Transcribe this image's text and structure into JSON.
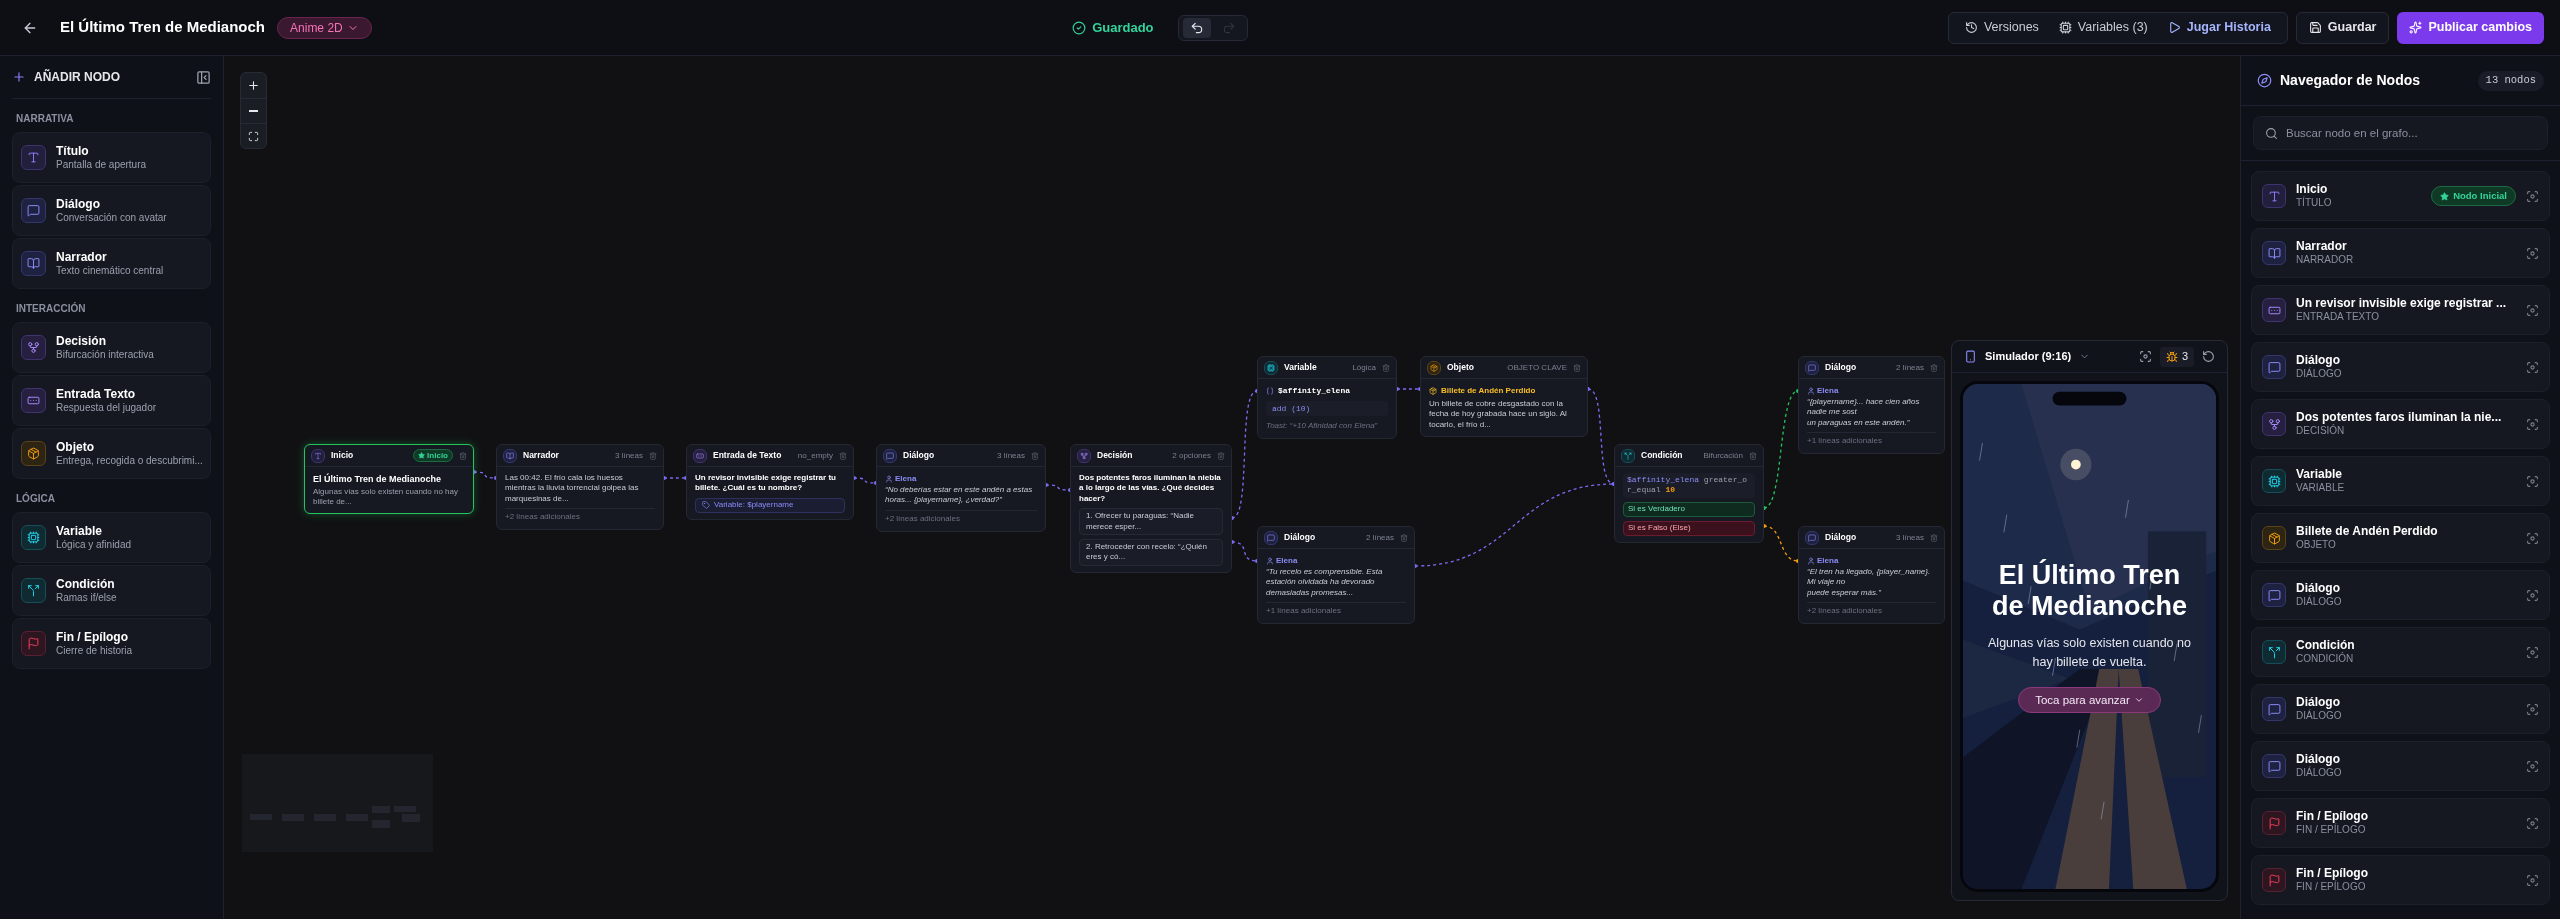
{
  "header": {
    "title": "El Último Tren de Medianoch",
    "tag": "Anime 2D",
    "status": "Guardado",
    "history": [
      {
        "kind": "undo",
        "disabled": false
      },
      {
        "kind": "redo",
        "disabled": true
      }
    ],
    "tools": [
      {
        "kind": "versions",
        "label": "Versiones"
      },
      {
        "kind": "variables",
        "label": "Variables (3)"
      },
      {
        "kind": "play",
        "label": "Jugar Historia"
      }
    ],
    "save": "Guardar",
    "publish": "Publicar cambios"
  },
  "sidebar": {
    "heading": "AÑADIR NODO",
    "sections": [
      {
        "title": "NARRATIVA",
        "items": [
          {
            "kind": "title",
            "title": "Título",
            "subtitle": "Pantalla de apertura"
          },
          {
            "kind": "dialog",
            "title": "Diálogo",
            "subtitle": "Conversación con avatar"
          },
          {
            "kind": "narrator",
            "title": "Narrador",
            "subtitle": "Texto cinemático central"
          }
        ]
      },
      {
        "title": "INTERACCIÓN",
        "items": [
          {
            "kind": "decision",
            "title": "Decisión",
            "subtitle": "Bifurcación interactiva"
          },
          {
            "kind": "input",
            "title": "Entrada Texto",
            "subtitle": "Respuesta del jugador"
          },
          {
            "kind": "object",
            "title": "Objeto",
            "subtitle": "Entrega, recogida o descubrimi..."
          }
        ]
      },
      {
        "title": "LÓGICA",
        "items": [
          {
            "kind": "variable",
            "title": "Variable",
            "subtitle": "Lógica y afinidad"
          },
          {
            "kind": "condition",
            "title": "Condición",
            "subtitle": "Ramas if/else"
          },
          {
            "kind": "end",
            "title": "Fin / Epílogo",
            "subtitle": "Cierre de historia"
          }
        ]
      }
    ]
  },
  "canvas": {
    "nodes": [
      {
        "kind": "title",
        "title": "Inicio",
        "selected": true,
        "badge": "Inicio",
        "heading": "El Último Tren de Medianoche",
        "text": "Algunas vías solo existen cuando no hay billete de..."
      },
      {
        "kind": "narrator",
        "title": "Narrador",
        "selected": false,
        "meta": "3 líneas",
        "text": "Las 00:42. El frío cala los huesos mientras la lluvia torrencial golpea las marquesinas de...",
        "footer": "+2 líneas adicionales"
      },
      {
        "kind": "input",
        "title": "Entrada de Texto",
        "selected": false,
        "meta": "no_empty",
        "heading": "Un revisor invisible exige registrar tu billete. ¿Cuál es tu nombre?",
        "field": "Variable: $playername"
      },
      {
        "kind": "dialog",
        "title": "Diálogo",
        "selected": false,
        "meta": "3 líneas",
        "speaker": "Elena",
        "lines": [
          "“No deberías estar en este andén a estas horas... {playername}, ¿verdad?”"
        ],
        "footer": "+2 líneas adicionales"
      },
      {
        "kind": "decision",
        "title": "Decisión",
        "selected": false,
        "meta": "2 opciones",
        "heading": "Dos potentes faros iluminan la niebla a lo largo de las vías. ¿Qué decides hacer?",
        "options": [
          "1. Ofrecer tu paraguas: “Nadie merece esper...",
          "2. Retroceder con recelo: “¿Quién eres y có..."
        ]
      },
      {
        "kind": "variable",
        "title": "Variable",
        "selected": false,
        "meta": "Lógica",
        "variable": "$affinity_elena",
        "operation": "add (10)",
        "toast": "Toast: “+10 Afinidad con Elena”"
      },
      {
        "kind": "object",
        "title": "Objeto",
        "selected": false,
        "meta": "OBJETO CLAVE",
        "name": "Billete de Andén Perdido",
        "text": "Un billete de cobre desgastado con la fecha de hoy grabada hace un siglo. Al tocarlo, el frío d..."
      },
      {
        "kind": "dialog",
        "title": "Diálogo",
        "selected": false,
        "meta": "2 líneas",
        "speaker": "Elena",
        "lines": [
          "“Tu recelo es comprensible. Esta estación olvidada ha devorado demasiadas promesas..."
        ],
        "footer": "+1 líneas adicionales"
      },
      {
        "kind": "condition",
        "title": "Condición",
        "selected": false,
        "meta": "Bifurcación",
        "expression": {
          "variable": "$affinity_elena",
          "operator": "greater_or_equal",
          "value": "10"
        },
        "branches": [
          {
            "kind": "true",
            "label": "Si es Verdadero"
          },
          {
            "kind": "false",
            "label": "Si es Falso (Else)"
          }
        ]
      },
      {
        "kind": "dialog",
        "title": "Diálogo",
        "selected": false,
        "meta": "2 líneas",
        "speaker": "Elena",
        "lines": [
          "“{playername}... hace cien años nadie me sost",
          "un paraguas en este andén.”"
        ],
        "footer": "+1 líneas adicionales"
      },
      {
        "kind": "dialog",
        "title": "Diálogo",
        "selected": false,
        "meta": "3 líneas",
        "speaker": "Elena",
        "lines": [
          "“El tren ha llegado, {player_name}. Mi viaje no",
          "puede esperar más.”"
        ],
        "footer": "+2 líneas adicionales"
      }
    ]
  },
  "simulator": {
    "title": "Simulador (9:16)",
    "bugs": "3",
    "heading": "El Último Tren de Medianoche",
    "subtitle": "Algunas vías solo existen cuando no hay billete de vuelta.",
    "button": "Toca para avanzar"
  },
  "navigator": {
    "title": "Navegador de Nodos",
    "count": "13 nodos",
    "search": {
      "placeholder": "Buscar nodo en el grafo..."
    },
    "items": [
      {
        "kind": "title",
        "title": "Inicio",
        "type": "TÍTULO",
        "badge": "Nodo Inicial"
      },
      {
        "kind": "narrator",
        "title": "Narrador",
        "type": "NARRADOR"
      },
      {
        "kind": "input",
        "title": "Un revisor invisible exige registrar ...",
        "type": "ENTRADA TEXTO"
      },
      {
        "kind": "dialog",
        "title": "Diálogo",
        "type": "DIÁLOGO"
      },
      {
        "kind": "decision",
        "title": "Dos potentes faros iluminan la nie...",
        "type": "DECISIÓN"
      },
      {
        "kind": "variable",
        "title": "Variable",
        "type": "VARIABLE"
      },
      {
        "kind": "object",
        "title": "Billete de Andén Perdido",
        "type": "OBJETO"
      },
      {
        "kind": "dialog",
        "title": "Diálogo",
        "type": "DIÁLOGO"
      },
      {
        "kind": "condition",
        "title": "Condición",
        "type": "CONDICIÓN"
      },
      {
        "kind": "dialog",
        "title": "Diálogo",
        "type": "DIÁLOGO"
      },
      {
        "kind": "dialog",
        "title": "Diálogo",
        "type": "DIÁLOGO"
      },
      {
        "kind": "end",
        "title": "Fin / Epílogo",
        "type": "FIN / EPÍLOGO"
      },
      {
        "kind": "end",
        "title": "Fin / Epílogo",
        "type": "FIN / EPÍLOGO"
      }
    ]
  }
}
